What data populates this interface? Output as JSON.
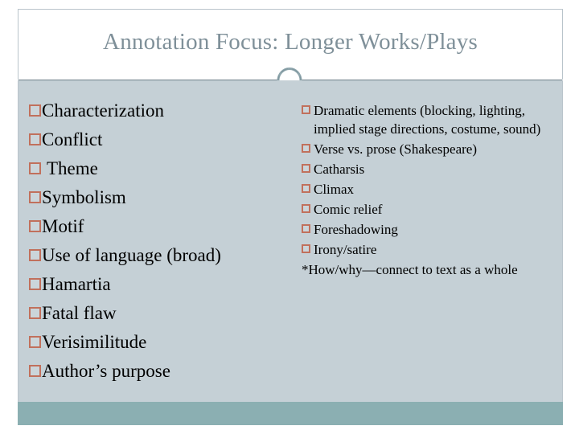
{
  "slide": {
    "title": "Annotation Focus: Longer Works/Plays",
    "ornament_icon": "ring-ornament-icon",
    "colors": {
      "title_text": "#7f9099",
      "body_background": "#c5d0d6",
      "footer_bar": "#8bafb2",
      "bullet_outline": "#c1705c",
      "rule": "#6d7f89",
      "body_text": "#000000"
    }
  },
  "left_column": {
    "items": [
      {
        "label": "Characterization",
        "extra_space": false
      },
      {
        "label": "Conflict",
        "extra_space": false
      },
      {
        "label": "Theme",
        "extra_space": true
      },
      {
        "label": "Symbolism",
        "extra_space": false
      },
      {
        "label": "Motif",
        "extra_space": false
      },
      {
        "label": "Use of language (broad)",
        "extra_space": false
      },
      {
        "label": "Hamartia",
        "extra_space": false
      },
      {
        "label": "Fatal flaw",
        "extra_space": false
      },
      {
        "label": "Verisimilitude",
        "extra_space": false
      },
      {
        "label": "Author’s purpose",
        "extra_space": false
      }
    ]
  },
  "right_column": {
    "items": [
      {
        "label": "Dramatic elements (blocking, lighting, implied stage directions, costume, sound)"
      },
      {
        "label": "Verse vs. prose (Shakespeare)"
      },
      {
        "label": "Catharsis"
      },
      {
        "label": "Climax"
      },
      {
        "label": "Comic relief"
      },
      {
        "label": "Foreshadowing"
      },
      {
        "label": "Irony/satire"
      }
    ],
    "closing_note": "*How/why—connect to text as a whole"
  }
}
